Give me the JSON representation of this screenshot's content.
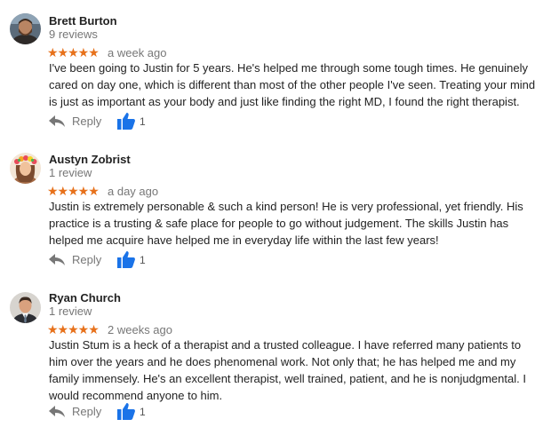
{
  "colors": {
    "star": "#e7711b",
    "meta": "#777777",
    "like_icon": "#1a73e8",
    "reply_icon": "#777777"
  },
  "reviews": [
    {
      "name": "Brett Burton",
      "review_count": "9 reviews",
      "rating": 5,
      "stars": "★★★★★",
      "time": "a week ago",
      "text": "I've been going to Justin for 5 years.  He's helped me through some tough times.  He genuinely cared on day one, which is different than most of the other people I've seen.  Treating your mind is just as important as your body and just like finding the right MD, I found the right therapist.",
      "reply_label": "Reply",
      "likes": "1",
      "avatar_icon": "man-with-beard-avatar"
    },
    {
      "name": "Austyn Zobrist",
      "review_count": "1 review",
      "rating": 5,
      "stars": "★★★★★",
      "time": "a day ago",
      "text": "Justin is extremely personable & such a kind person! He is very professional, yet friendly. His practice is a trusting & safe place for people to go without judgement. The skills Justin has helped me acquire have helped me in everyday life within the last few years!",
      "reply_label": "Reply",
      "likes": "1",
      "avatar_icon": "woman-with-flower-crown-avatar"
    },
    {
      "name": "Ryan Church",
      "review_count": "1 review",
      "rating": 5,
      "stars": "★★★★★",
      "time": "2 weeks ago",
      "text": "Justin Stum is a heck of a therapist and a trusted colleague. I have referred many patients to him over the years and he does phenomenal work. Not only that; he has helped me and my family immensely. He's an excellent therapist, well trained, patient, and he is nonjudgmental. I would recommend anyone to him.",
      "reply_label": "Reply",
      "likes": "1",
      "avatar_icon": "man-in-suit-avatar"
    }
  ]
}
